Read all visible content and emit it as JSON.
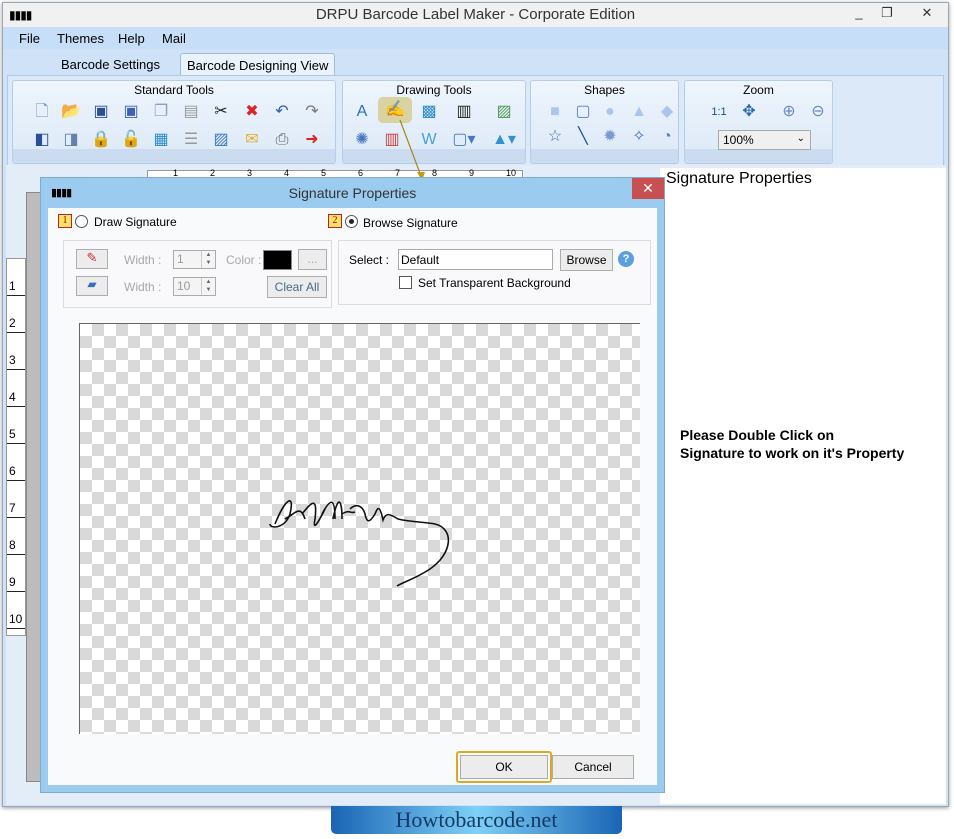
{
  "window": {
    "title": "DRPU Barcode Label Maker - Corporate Edition",
    "minimize": "_",
    "maximize": "❐",
    "close": "✕"
  },
  "menu": [
    "File",
    "Themes",
    "Help",
    "Mail"
  ],
  "tabs": [
    {
      "label": "Barcode Settings",
      "active": false
    },
    {
      "label": "Barcode Designing View",
      "active": true
    }
  ],
  "ribbon": {
    "standard_tools": {
      "label": "Standard Tools",
      "icons": [
        "new-file",
        "open-folder",
        "save",
        "save-as",
        "copy",
        "paste",
        "cut",
        "delete",
        "undo",
        "redo",
        "send-back",
        "bring-front",
        "lock",
        "unlock",
        "grid",
        "database",
        "export-image",
        "email",
        "print",
        "exit"
      ]
    },
    "drawing_tools": {
      "label": "Drawing Tools",
      "icons": [
        "text",
        "signature",
        "picture",
        "barcode",
        "image-box",
        "blob-shape",
        "library",
        "word-art",
        "frame-dropdown",
        "shapes-dropdown"
      ]
    },
    "shapes": {
      "label": "Shapes",
      "icons": [
        "rectangle",
        "rounded-rectangle",
        "ellipse",
        "triangle",
        "diamond",
        "star",
        "line",
        "burst",
        "four-point-star",
        "pie"
      ]
    },
    "zoom": {
      "label": "Zoom",
      "icons": [
        "actual-size",
        "fit-to-window",
        "zoom-in",
        "zoom-out"
      ],
      "value": "100%"
    }
  },
  "ruler": {
    "vertical": [
      "1",
      "2",
      "3",
      "4",
      "5",
      "6",
      "7",
      "8",
      "9",
      "10"
    ],
    "horizontal": [
      "1",
      "2",
      "3",
      "4",
      "5",
      "6",
      "7",
      "8",
      "9",
      "10"
    ]
  },
  "side_label": "Signature Properties",
  "hint": [
    "Please Double Click on",
    "Signature to work on it's Property"
  ],
  "dialog": {
    "title": "Signature Properties",
    "close": "✕",
    "draw": {
      "badge": "1",
      "label": "Draw Signature",
      "selected": false,
      "width_label": "Width :",
      "pen_width": "1",
      "eraser_width": "10",
      "color_label": "Color :",
      "color": "#000000",
      "more": "...",
      "clear_all": "Clear All"
    },
    "browse": {
      "badge": "2",
      "label": "Browse Signature",
      "selected": true,
      "select_label": "Select :",
      "select_value": "Default",
      "browse_button": "Browse",
      "transparent_label": "Set Transparent Background",
      "transparent_checked": false
    },
    "ok": "OK",
    "cancel": "Cancel"
  },
  "footer": "Howtobarcode.net"
}
